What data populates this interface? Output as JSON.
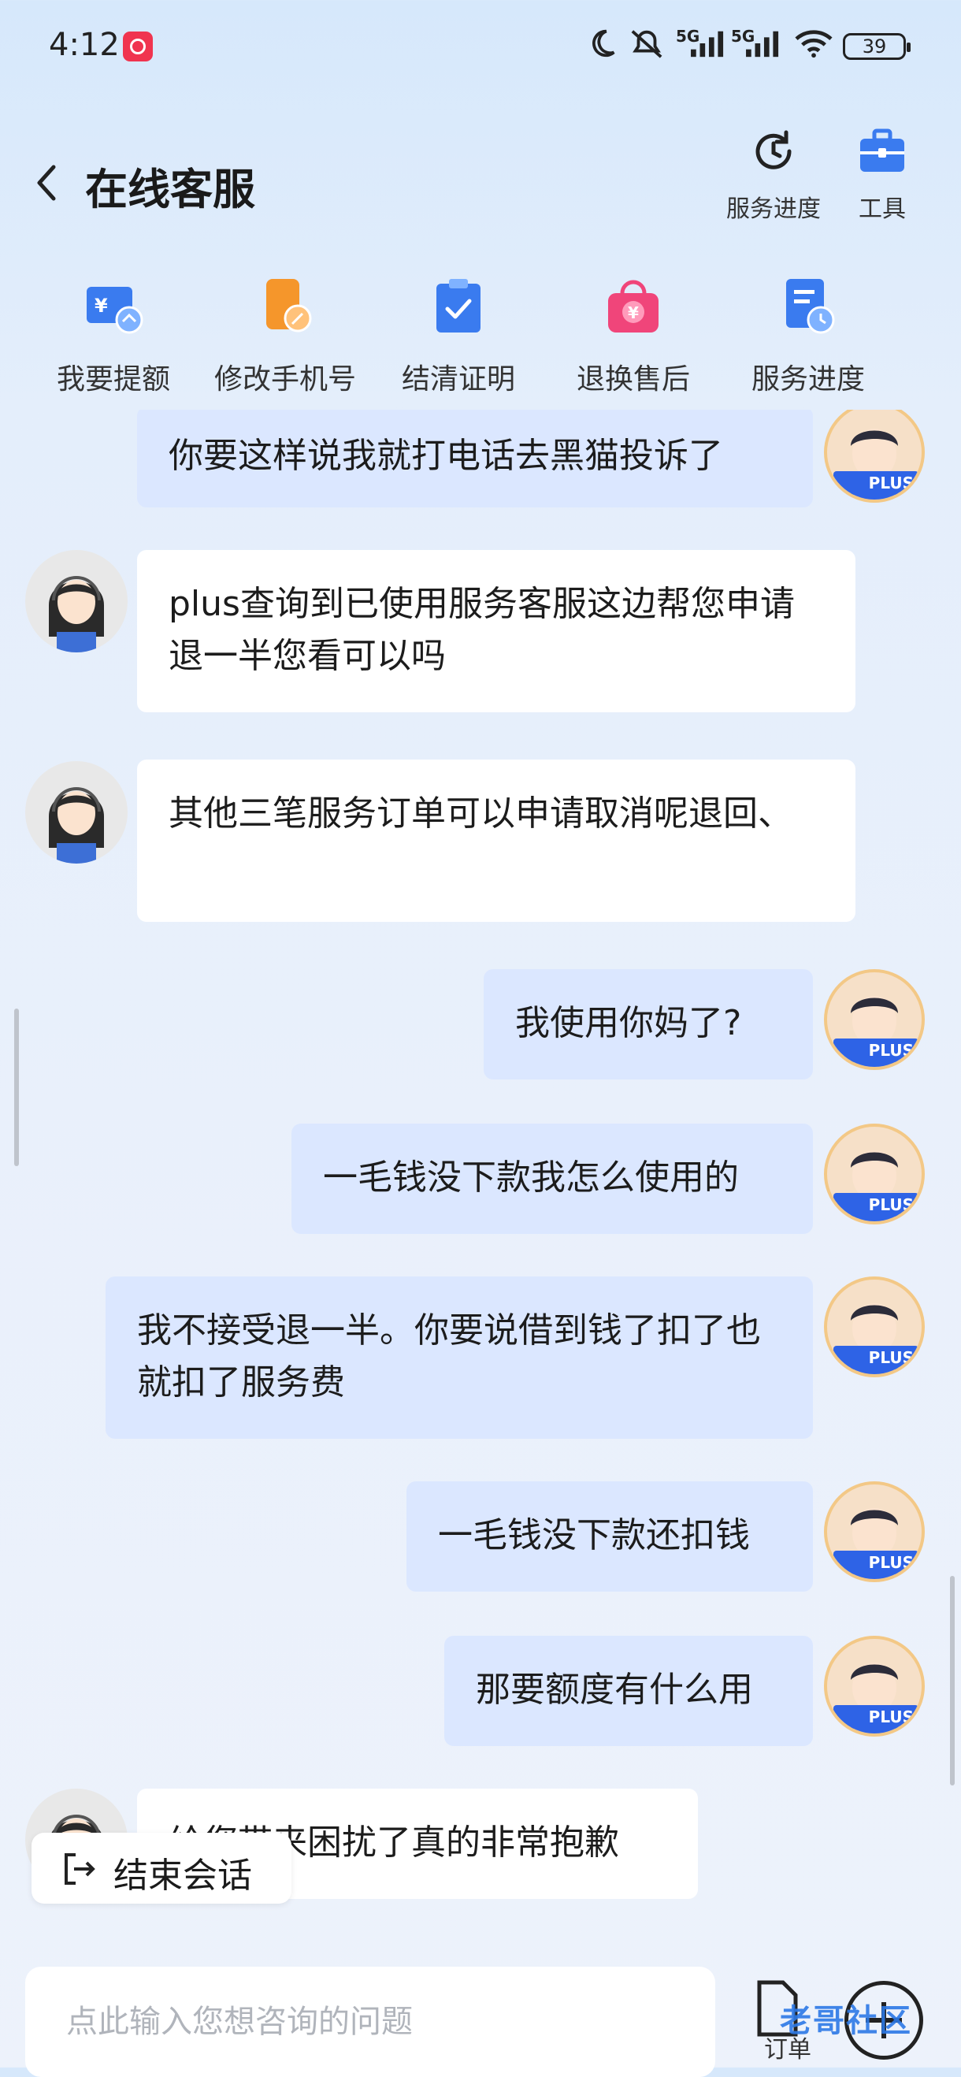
{
  "status_bar": {
    "time": "4:12",
    "battery": "39",
    "network_1": "5G",
    "network_2": "5G"
  },
  "header": {
    "title": "在线客服",
    "tools": [
      {
        "label": "服务进度",
        "icon": "history-clock-icon"
      },
      {
        "label": "工具",
        "icon": "toolbox-icon"
      }
    ]
  },
  "quick_actions": [
    {
      "label": "我要提额",
      "icon": "credit-raise-icon"
    },
    {
      "label": "修改手机号",
      "icon": "edit-phone-icon"
    },
    {
      "label": "结清证明",
      "icon": "clipboard-check-icon"
    },
    {
      "label": "退换售后",
      "icon": "shopping-bag-yuan-icon"
    },
    {
      "label": "服务进度",
      "icon": "document-clock-icon"
    }
  ],
  "messages": [
    {
      "from": "user",
      "text": "你要这样说我就打电话去黑猫投诉了"
    },
    {
      "from": "agent",
      "text": "plus查询到已使用服务客服这边帮您申请退一半您看可以吗"
    },
    {
      "from": "agent",
      "text": "其他三笔服务订单可以申请取消呢退回、"
    },
    {
      "from": "user",
      "text": "我使用你妈了?"
    },
    {
      "from": "user",
      "text": "一毛钱没下款我怎么使用的"
    },
    {
      "from": "user",
      "text": "我不接受退一半。你要说借到钱了扣了也就扣了服务费"
    },
    {
      "from": "user",
      "text": "一毛钱没下款还扣钱"
    },
    {
      "from": "user",
      "text": "那要额度有什么用"
    },
    {
      "from": "agent",
      "text": "给您带来困扰了真的非常抱歉"
    }
  ],
  "user_badge": "PLUS",
  "end_session": {
    "label": "结束会话"
  },
  "input": {
    "placeholder": "点此输入您想咨询的问题"
  },
  "order_button": {
    "label": "订单"
  },
  "watermark": "老哥社区",
  "colors": {
    "accent": "#3a7bef",
    "user_bubble": "#dbe7ff",
    "agent_bubble": "#ffffff",
    "qa_orange": "#f5962b",
    "qa_pink": "#f0457a"
  }
}
